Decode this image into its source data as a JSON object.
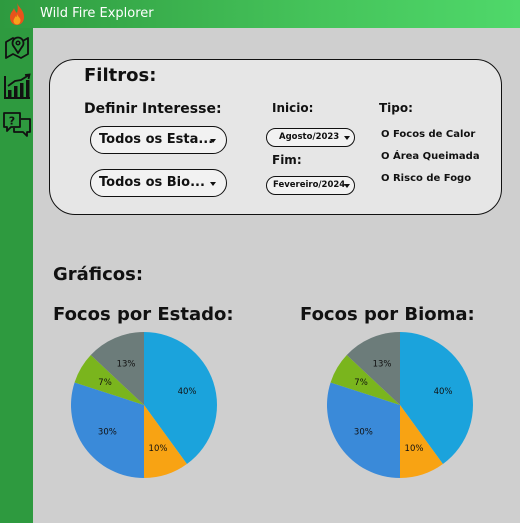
{
  "app": {
    "title": "Wild Fire Explorer"
  },
  "sidebar": [
    {
      "icon": "map-pin-icon"
    },
    {
      "icon": "chart-icon"
    },
    {
      "icon": "help-chat-icon"
    }
  ],
  "filters": {
    "title": "Filtros:",
    "interest_label": "Definir Interesse:",
    "state_select": "Todos os Esta...",
    "biome_select": "Todos os Bio...",
    "start_label": "Inicio:",
    "start_value": "Agosto/2023",
    "end_label": "Fim:",
    "end_value": "Fevereiro/2024",
    "type_label": "Tipo:",
    "types": [
      "O Focos de Calor",
      "O Área Queimada",
      "O Risco de Fogo"
    ]
  },
  "graphs": {
    "title": "Gráficos:",
    "state_chart_title": "Focos por Estado:",
    "biome_chart_title": "Focos por Bioma:"
  },
  "colors": {
    "blue_light": "#1ba3dc",
    "orange": "#f8a313",
    "blue": "#3a8ad9",
    "green": "#7ab51d",
    "gray": "#6c7c7a"
  },
  "chart_data": [
    {
      "type": "pie",
      "title": "Focos por Estado:",
      "values": [
        40,
        10,
        30,
        7,
        13
      ],
      "labels": [
        "40%",
        "10%",
        "30%",
        "7%",
        "13%"
      ],
      "colors": [
        "#1ba3dc",
        "#f8a313",
        "#3a8ad9",
        "#7ab51d",
        "#6c7c7a"
      ]
    },
    {
      "type": "pie",
      "title": "Focos por Bioma:",
      "values": [
        40,
        10,
        30,
        7,
        13
      ],
      "labels": [
        "40%",
        "10%",
        "30%",
        "7%",
        "13%"
      ],
      "colors": [
        "#1ba3dc",
        "#f8a313",
        "#3a8ad9",
        "#7ab51d",
        "#6c7c7a"
      ]
    }
  ]
}
